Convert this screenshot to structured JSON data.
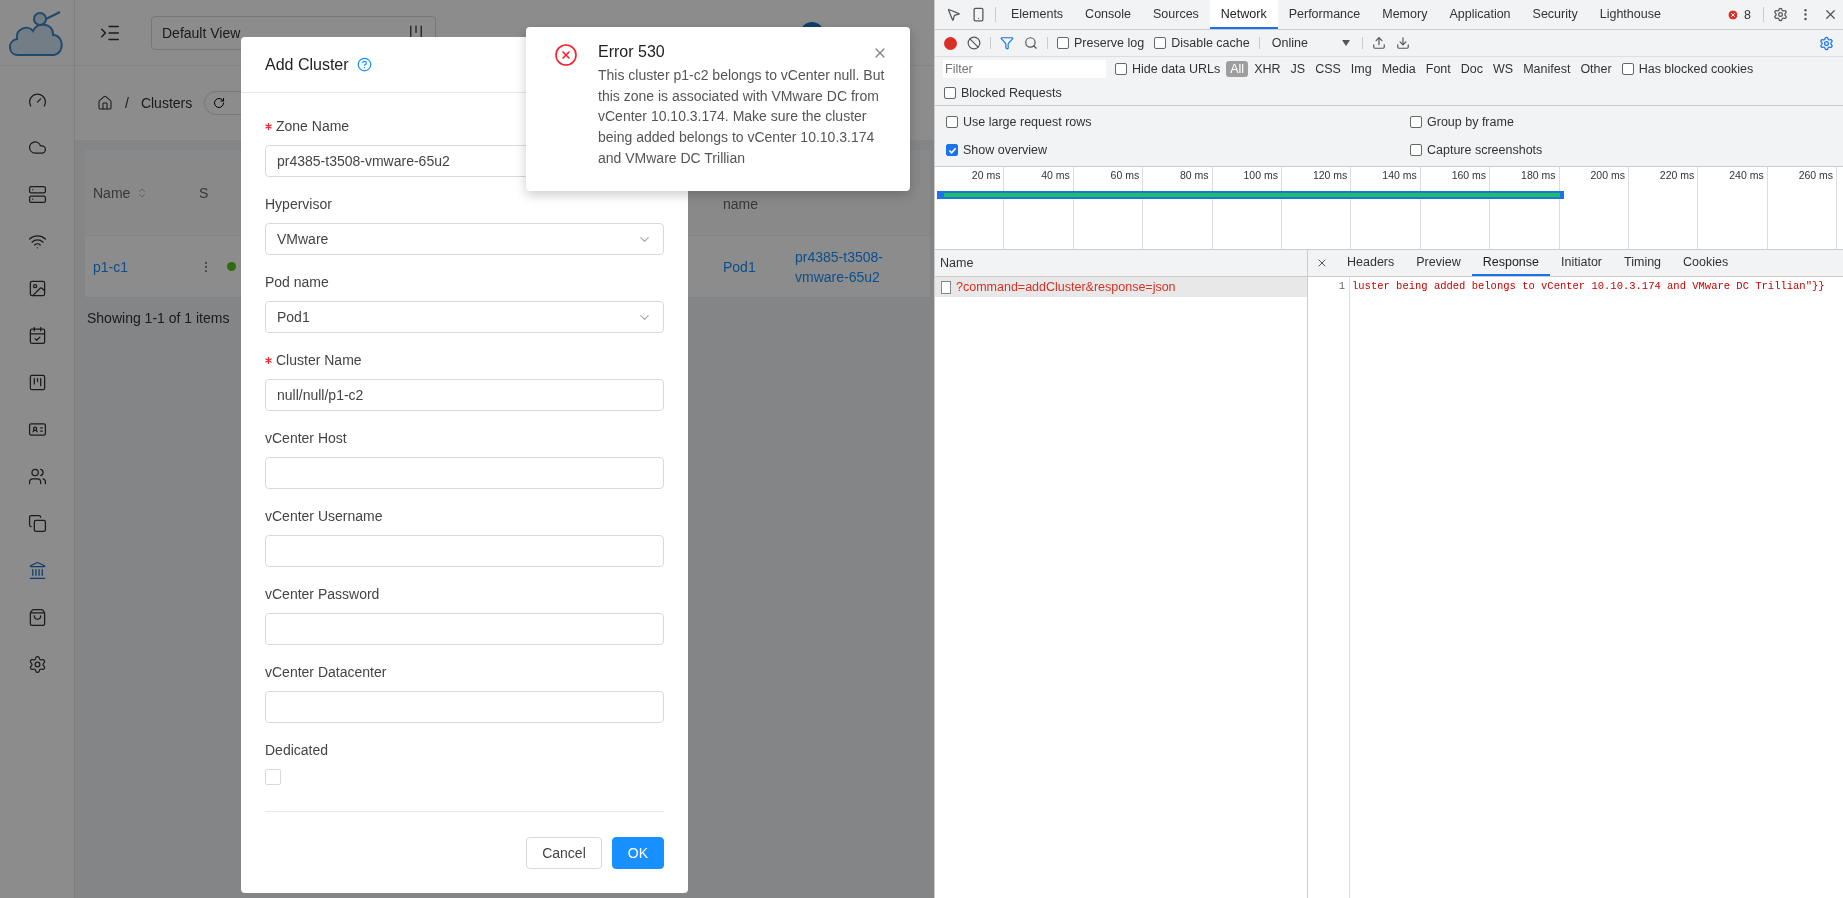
{
  "app": {
    "header": {
      "view_select": "Default View"
    },
    "sidebar": {
      "items": [
        {
          "selected": false
        },
        {
          "selected": false
        },
        {
          "selected": false
        },
        {
          "selected": false
        },
        {
          "selected": false
        },
        {
          "selected": false
        },
        {
          "selected": false
        },
        {
          "selected": false
        },
        {
          "selected": false
        },
        {
          "selected": false
        },
        {
          "selected": true
        },
        {
          "selected": false
        },
        {
          "selected": false
        }
      ]
    },
    "breadcrumb": {
      "separator": "/",
      "current": "Clusters"
    },
    "table": {
      "columns": [
        "Name",
        "S",
        "name"
      ],
      "rows": [
        {
          "name": "p1-c1",
          "pod": "Pod1",
          "zone": "pr4385-t3508-vmware-65u2"
        }
      ]
    },
    "pagination": "Showing 1-1 of 1 items"
  },
  "modal": {
    "title": "Add Cluster",
    "fields": [
      {
        "kind": "input",
        "label": "Zone Name",
        "required": true,
        "value": "pr4385-t3508-vmware-65u2"
      },
      {
        "kind": "select",
        "label": "Hypervisor",
        "required": false,
        "value": "VMware"
      },
      {
        "kind": "select",
        "label": "Pod name",
        "required": false,
        "value": "Pod1"
      },
      {
        "kind": "input",
        "label": "Cluster Name",
        "required": true,
        "value": "null/null/p1-c2"
      },
      {
        "kind": "input",
        "label": "vCenter Host",
        "required": false
      },
      {
        "kind": "input",
        "label": "vCenter Username",
        "required": false
      },
      {
        "kind": "input",
        "label": "vCenter Password",
        "required": false
      },
      {
        "kind": "input",
        "label": "vCenter Datacenter",
        "required": false
      },
      {
        "kind": "checkbox",
        "label": "Dedicated",
        "required": false,
        "checked": false
      }
    ],
    "buttons": [
      {
        "label": "Cancel",
        "primary": false
      },
      {
        "label": "OK",
        "primary": true
      }
    ]
  },
  "notification": {
    "title": "Error 530",
    "message": "This cluster p1-c2 belongs to vCenter null. But this zone is associated with VMware DC from vCenter 10.10.3.174. Make sure the cluster being added belongs to vCenter 10.10.3.174 and VMware DC Trillian"
  },
  "devtools": {
    "tabs": [
      {
        "label": "Elements",
        "selected": false
      },
      {
        "label": "Console",
        "selected": false
      },
      {
        "label": "Sources",
        "selected": false
      },
      {
        "label": "Network",
        "selected": true
      },
      {
        "label": "Performance",
        "selected": false
      },
      {
        "label": "Memory",
        "selected": false
      },
      {
        "label": "Application",
        "selected": false
      },
      {
        "label": "Security",
        "selected": false
      },
      {
        "label": "Lighthouse",
        "selected": false
      }
    ],
    "error_count": "8",
    "toolbar": {
      "preserve_log": {
        "label": "Preserve log",
        "checked": false
      },
      "disable_cache": {
        "label": "Disable cache",
        "checked": false
      },
      "throttling": "Online"
    },
    "filter": {
      "placeholder": "Filter",
      "hide_data_urls": {
        "label": "Hide data URLs",
        "checked": false
      },
      "types": [
        {
          "label": "All",
          "selected": true
        },
        {
          "label": "XHR",
          "selected": false
        },
        {
          "label": "JS",
          "selected": false
        },
        {
          "label": "CSS",
          "selected": false
        },
        {
          "label": "Img",
          "selected": false
        },
        {
          "label": "Media",
          "selected": false
        },
        {
          "label": "Font",
          "selected": false
        },
        {
          "label": "Doc",
          "selected": false
        },
        {
          "label": "WS",
          "selected": false
        },
        {
          "label": "Manifest",
          "selected": false
        },
        {
          "label": "Other",
          "selected": false
        }
      ],
      "has_blocked_cookies": {
        "label": "Has blocked cookies",
        "checked": false
      },
      "blocked_requests": {
        "label": "Blocked Requests",
        "checked": false
      }
    },
    "settings": [
      {
        "label": "Use large request rows",
        "checked": false
      },
      {
        "label": "Group by frame",
        "checked": false
      },
      {
        "label": "Show overview",
        "checked": true
      },
      {
        "label": "Capture screenshots",
        "checked": false
      }
    ],
    "overview_ticks": [
      "20 ms",
      "40 ms",
      "60 ms",
      "80 ms",
      "100 ms",
      "120 ms",
      "140 ms",
      "160 ms",
      "180 ms",
      "200 ms",
      "220 ms",
      "240 ms",
      "260 ms"
    ],
    "requests": {
      "column": "Name",
      "rows": [
        {
          "name": "?command=addCluster&response=json",
          "selected": true
        }
      ]
    },
    "detail_tabs": [
      {
        "label": "Headers",
        "selected": false
      },
      {
        "label": "Preview",
        "selected": false
      },
      {
        "label": "Response",
        "selected": true
      },
      {
        "label": "Initiator",
        "selected": false
      },
      {
        "label": "Timing",
        "selected": false
      },
      {
        "label": "Cookies",
        "selected": false
      }
    ],
    "response": {
      "line": "1",
      "text": "luster being added belongs to vCenter 10.10.3.174 and VMware DC Trillian\"}}"
    }
  }
}
